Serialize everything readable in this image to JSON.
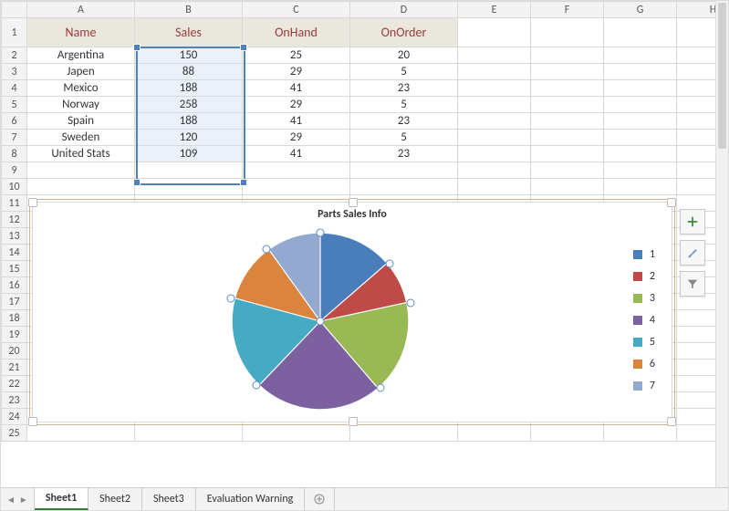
{
  "columns": [
    "A",
    "B",
    "C",
    "D",
    "E",
    "F",
    "G",
    "H"
  ],
  "header": {
    "name": "Name",
    "sales": "Sales",
    "onhand": "OnHand",
    "onorder": "OnOrder"
  },
  "rows": [
    {
      "name": "Argentina",
      "sales": "150",
      "onhand": "25",
      "onorder": "20"
    },
    {
      "name": "Japen",
      "sales": "88",
      "onhand": "29",
      "onorder": "5"
    },
    {
      "name": "Mexico",
      "sales": "188",
      "onhand": "41",
      "onorder": "23"
    },
    {
      "name": "Norway",
      "sales": "258",
      "onhand": "29",
      "onorder": "5"
    },
    {
      "name": "Spain",
      "sales": "188",
      "onhand": "41",
      "onorder": "23"
    },
    {
      "name": "Sweden",
      "sales": "120",
      "onhand": "29",
      "onorder": "5"
    },
    {
      "name": "United Stats",
      "sales": "109",
      "onhand": "41",
      "onorder": "23"
    }
  ],
  "row_numbers": [
    "1",
    "2",
    "3",
    "4",
    "5",
    "6",
    "7",
    "8",
    "9",
    "10",
    "11",
    "12",
    "13",
    "14",
    "15",
    "16",
    "17",
    "18",
    "19",
    "20",
    "21",
    "22",
    "23",
    "24",
    "25"
  ],
  "chart_data": {
    "type": "pie",
    "title": "Parts Sales Info",
    "categories": [
      "1",
      "2",
      "3",
      "4",
      "5",
      "6",
      "7"
    ],
    "values": [
      150,
      88,
      188,
      258,
      188,
      120,
      109
    ],
    "series_name": "Sales",
    "colors": [
      "#4a7ebb",
      "#be4b48",
      "#98b954",
      "#7d60a0",
      "#46aac5",
      "#db843d",
      "#93a9cf"
    ],
    "legend_position": "right"
  },
  "legend_labels": [
    "1",
    "2",
    "3",
    "4",
    "5",
    "6",
    "7"
  ],
  "tabs": {
    "active": "Sheet1",
    "list": [
      "Sheet1",
      "Sheet2",
      "Sheet3",
      "Evaluation Warning"
    ]
  }
}
